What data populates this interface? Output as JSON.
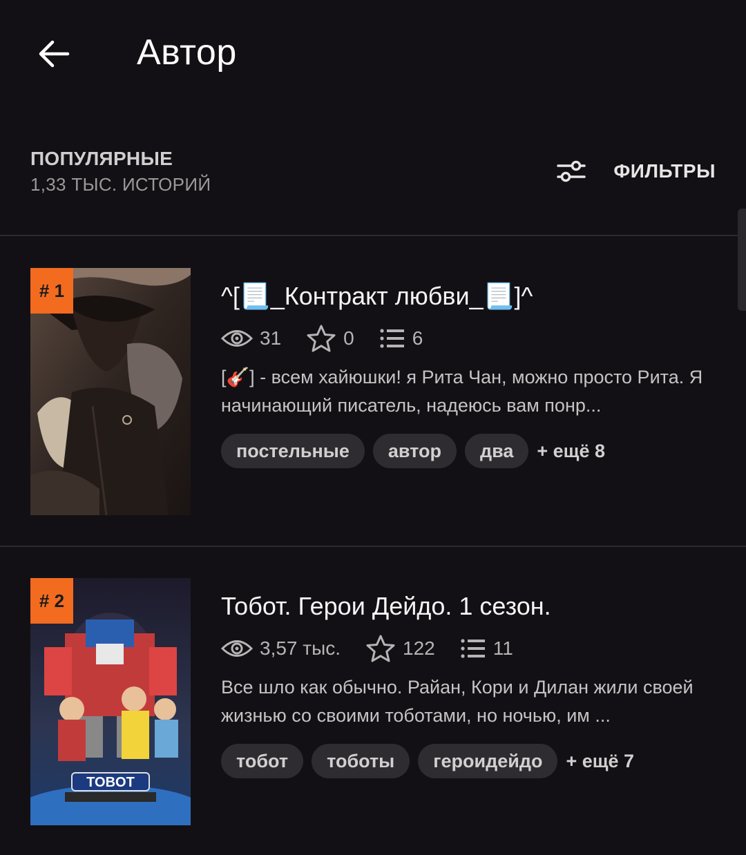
{
  "header": {
    "title": "Автор",
    "back_icon": "arrow-left-icon"
  },
  "sort": {
    "label": "ПОПУЛЯРНЫЕ",
    "count": "1,33 ТЫС. ИСТОРИЙ",
    "filters_label": "ФИЛЬТРЫ",
    "filters_icon": "sliders-icon"
  },
  "colors": {
    "accent": "#f26b1f",
    "background": "#121014",
    "tag_bg": "#2e2c30"
  },
  "stories": [
    {
      "rank": "# 1",
      "title": "^[📃_Контракт любви_📃]^",
      "reads": "31",
      "votes": "0",
      "parts": "6",
      "description": "[🎸] - всем хайюшки! я Рита Чан, можно просто Рита. Я начинающий писатель, надеюсь вам понр...",
      "tags": [
        "постельные",
        "автор",
        "два"
      ],
      "more_tags": "+ ещё 8"
    },
    {
      "rank": "# 2",
      "title": "Тобот. Герои Дейдо. 1 сезон.",
      "reads": "3,57 тыс.",
      "votes": "122",
      "parts": "11",
      "description": "Все шло как обычно. Райан, Кори и Дилан жили своей жизнью со своими тоботами, но ночью, им ...",
      "tags": [
        "тобот",
        "тоботы",
        "героидейдо"
      ],
      "more_tags": "+ ещё 7",
      "cover_logo": "TOBOT"
    }
  ]
}
